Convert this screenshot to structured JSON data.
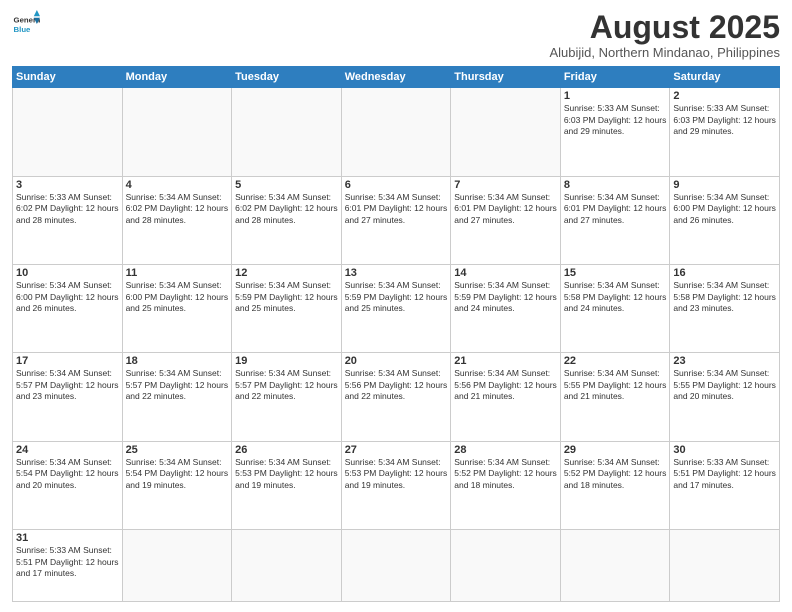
{
  "logo": {
    "general": "General",
    "blue": "Blue"
  },
  "header": {
    "month_year": "August 2025",
    "location": "Alubijid, Northern Mindanao, Philippines"
  },
  "weekdays": [
    "Sunday",
    "Monday",
    "Tuesday",
    "Wednesday",
    "Thursday",
    "Friday",
    "Saturday"
  ],
  "weeks": [
    [
      {
        "day": "",
        "info": ""
      },
      {
        "day": "",
        "info": ""
      },
      {
        "day": "",
        "info": ""
      },
      {
        "day": "",
        "info": ""
      },
      {
        "day": "",
        "info": ""
      },
      {
        "day": "1",
        "info": "Sunrise: 5:33 AM\nSunset: 6:03 PM\nDaylight: 12 hours and 29 minutes."
      },
      {
        "day": "2",
        "info": "Sunrise: 5:33 AM\nSunset: 6:03 PM\nDaylight: 12 hours and 29 minutes."
      }
    ],
    [
      {
        "day": "3",
        "info": "Sunrise: 5:33 AM\nSunset: 6:02 PM\nDaylight: 12 hours and 28 minutes."
      },
      {
        "day": "4",
        "info": "Sunrise: 5:34 AM\nSunset: 6:02 PM\nDaylight: 12 hours and 28 minutes."
      },
      {
        "day": "5",
        "info": "Sunrise: 5:34 AM\nSunset: 6:02 PM\nDaylight: 12 hours and 28 minutes."
      },
      {
        "day": "6",
        "info": "Sunrise: 5:34 AM\nSunset: 6:01 PM\nDaylight: 12 hours and 27 minutes."
      },
      {
        "day": "7",
        "info": "Sunrise: 5:34 AM\nSunset: 6:01 PM\nDaylight: 12 hours and 27 minutes."
      },
      {
        "day": "8",
        "info": "Sunrise: 5:34 AM\nSunset: 6:01 PM\nDaylight: 12 hours and 27 minutes."
      },
      {
        "day": "9",
        "info": "Sunrise: 5:34 AM\nSunset: 6:00 PM\nDaylight: 12 hours and 26 minutes."
      }
    ],
    [
      {
        "day": "10",
        "info": "Sunrise: 5:34 AM\nSunset: 6:00 PM\nDaylight: 12 hours and 26 minutes."
      },
      {
        "day": "11",
        "info": "Sunrise: 5:34 AM\nSunset: 6:00 PM\nDaylight: 12 hours and 25 minutes."
      },
      {
        "day": "12",
        "info": "Sunrise: 5:34 AM\nSunset: 5:59 PM\nDaylight: 12 hours and 25 minutes."
      },
      {
        "day": "13",
        "info": "Sunrise: 5:34 AM\nSunset: 5:59 PM\nDaylight: 12 hours and 25 minutes."
      },
      {
        "day": "14",
        "info": "Sunrise: 5:34 AM\nSunset: 5:59 PM\nDaylight: 12 hours and 24 minutes."
      },
      {
        "day": "15",
        "info": "Sunrise: 5:34 AM\nSunset: 5:58 PM\nDaylight: 12 hours and 24 minutes."
      },
      {
        "day": "16",
        "info": "Sunrise: 5:34 AM\nSunset: 5:58 PM\nDaylight: 12 hours and 23 minutes."
      }
    ],
    [
      {
        "day": "17",
        "info": "Sunrise: 5:34 AM\nSunset: 5:57 PM\nDaylight: 12 hours and 23 minutes."
      },
      {
        "day": "18",
        "info": "Sunrise: 5:34 AM\nSunset: 5:57 PM\nDaylight: 12 hours and 22 minutes."
      },
      {
        "day": "19",
        "info": "Sunrise: 5:34 AM\nSunset: 5:57 PM\nDaylight: 12 hours and 22 minutes."
      },
      {
        "day": "20",
        "info": "Sunrise: 5:34 AM\nSunset: 5:56 PM\nDaylight: 12 hours and 22 minutes."
      },
      {
        "day": "21",
        "info": "Sunrise: 5:34 AM\nSunset: 5:56 PM\nDaylight: 12 hours and 21 minutes."
      },
      {
        "day": "22",
        "info": "Sunrise: 5:34 AM\nSunset: 5:55 PM\nDaylight: 12 hours and 21 minutes."
      },
      {
        "day": "23",
        "info": "Sunrise: 5:34 AM\nSunset: 5:55 PM\nDaylight: 12 hours and 20 minutes."
      }
    ],
    [
      {
        "day": "24",
        "info": "Sunrise: 5:34 AM\nSunset: 5:54 PM\nDaylight: 12 hours and 20 minutes."
      },
      {
        "day": "25",
        "info": "Sunrise: 5:34 AM\nSunset: 5:54 PM\nDaylight: 12 hours and 19 minutes."
      },
      {
        "day": "26",
        "info": "Sunrise: 5:34 AM\nSunset: 5:53 PM\nDaylight: 12 hours and 19 minutes."
      },
      {
        "day": "27",
        "info": "Sunrise: 5:34 AM\nSunset: 5:53 PM\nDaylight: 12 hours and 19 minutes."
      },
      {
        "day": "28",
        "info": "Sunrise: 5:34 AM\nSunset: 5:52 PM\nDaylight: 12 hours and 18 minutes."
      },
      {
        "day": "29",
        "info": "Sunrise: 5:34 AM\nSunset: 5:52 PM\nDaylight: 12 hours and 18 minutes."
      },
      {
        "day": "30",
        "info": "Sunrise: 5:33 AM\nSunset: 5:51 PM\nDaylight: 12 hours and 17 minutes."
      }
    ],
    [
      {
        "day": "31",
        "info": "Sunrise: 5:33 AM\nSunset: 5:51 PM\nDaylight: 12 hours and 17 minutes."
      },
      {
        "day": "",
        "info": ""
      },
      {
        "day": "",
        "info": ""
      },
      {
        "day": "",
        "info": ""
      },
      {
        "day": "",
        "info": ""
      },
      {
        "day": "",
        "info": ""
      },
      {
        "day": "",
        "info": ""
      }
    ]
  ]
}
